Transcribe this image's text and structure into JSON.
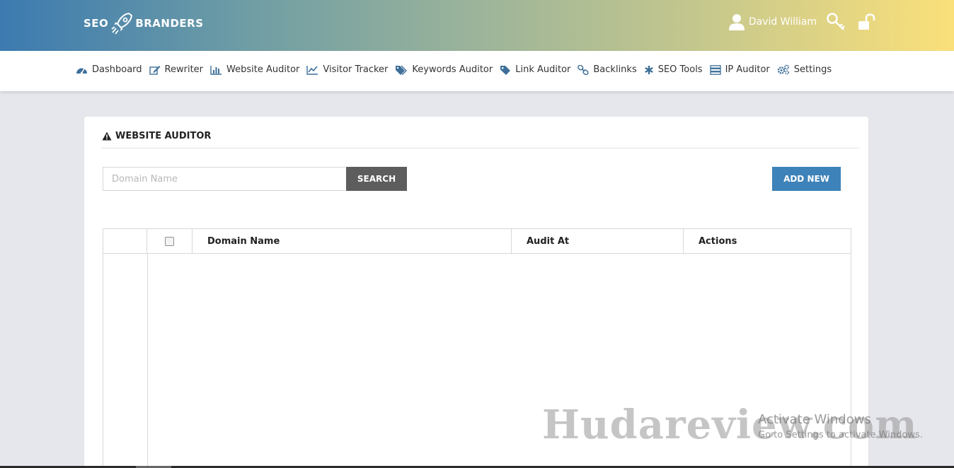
{
  "header": {
    "logo_left": "SEO",
    "logo_right": "BRANDERS",
    "user_name": "David William"
  },
  "nav": {
    "items": [
      {
        "label": "Dashboard",
        "icon": "dashboard-icon"
      },
      {
        "label": "Rewriter",
        "icon": "edit-icon"
      },
      {
        "label": "Website Auditor",
        "icon": "bar-chart-icon"
      },
      {
        "label": "Visitor Tracker",
        "icon": "line-chart-icon"
      },
      {
        "label": "Keywords Auditor",
        "icon": "tags-icon"
      },
      {
        "label": "Link Auditor",
        "icon": "tag-icon"
      },
      {
        "label": "Backlinks",
        "icon": "link-icon"
      },
      {
        "label": "SEO Tools",
        "icon": "asterisk-icon"
      },
      {
        "label": "IP Auditor",
        "icon": "server-icon"
      },
      {
        "label": "Settings",
        "icon": "cogs-icon"
      }
    ]
  },
  "panel": {
    "title": "WEBSITE AUDITOR",
    "search_placeholder": "Domain Name",
    "search_label": "SEARCH",
    "add_label": "ADD NEW"
  },
  "table": {
    "columns": [
      "",
      "",
      "Domain Name",
      "Audit At",
      "Actions"
    ]
  },
  "overlay": {
    "watermark": "Hudareview.com",
    "activate_title": "Activate Windows",
    "activate_sub": "Go to Settings to activate Windows."
  },
  "colors": {
    "accent": "#3d82b8",
    "search_button": "#5d5d5d",
    "nav_icon": "#3d6f99"
  }
}
